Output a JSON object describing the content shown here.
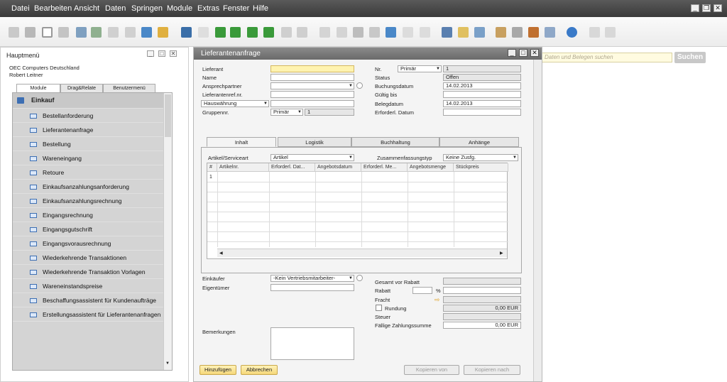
{
  "menubar": {
    "items": [
      "Datei",
      "Bearbeiten",
      "Ansicht",
      "Daten",
      "Springen",
      "Module",
      "Extras",
      "Fenster",
      "Hilfe"
    ]
  },
  "search": {
    "placeholder": "Daten und Belegen suchen",
    "button": "Suchen"
  },
  "hauptmenu": {
    "title": "Hauptmenü",
    "company": "OEC Computers Deutschland",
    "user": "Robert Leitner",
    "tabs": [
      "Module",
      "Drag&Relate",
      "Benutzermenü"
    ],
    "module": "Einkauf",
    "items": [
      "Bestellanforderung",
      "Lieferantenanfrage",
      "Bestellung",
      "Wareneingang",
      "Retoure",
      "Einkaufsanzahlungsanforderung",
      "Einkaufsanzahlungsrechnung",
      "Eingangsrechnung",
      "Eingangsgutschrift",
      "Eingangsvorausrechnung",
      "Wiederkehrende Transaktionen",
      "Wiederkehrende Transaktion Vorlagen",
      "Wareneinstandspreise",
      "Beschaffungsassistent für Kundenaufträge",
      "Erstellungsassistent für Lieferantenanfragen"
    ]
  },
  "dialog": {
    "title": "Lieferantenanfrage",
    "left": {
      "lieferant": "Lieferant",
      "name": "Name",
      "ansprechpartner": "Ansprechpartner",
      "refnr": "Lieferantenref.nr.",
      "waehrung": "Hauswährung",
      "gruppennr": "Gruppennr.",
      "gruppe_serie": "Primär",
      "gruppe_value": "1"
    },
    "right": {
      "nr": "Nr.",
      "nr_serie": "Primär",
      "nr_value": "1",
      "status": "Status",
      "status_value": "Offen",
      "buchungsdatum": "Buchungsdatum",
      "buchungsdatum_value": "14.02.2013",
      "gueltig": "Gültig bis",
      "belegdatum": "Belegdatum",
      "belegdatum_value": "14.02.2013",
      "erf_datum": "Erforderl. Datum"
    },
    "tabs": [
      "Inhalt",
      "Logistik",
      "Buchhaltung",
      "Anhänge"
    ],
    "content": {
      "artikel_label": "Artikel/Serviceart",
      "artikel_value": "Artikel",
      "zusammen_label": "Zusammenfassungstyp",
      "zusammen_value": "Keine Zusfg.",
      "columns": [
        "#",
        "Artikelnr.",
        "Erforderl. Dat...",
        "Angebotsdatum",
        "Erforderl. Me...",
        "Angebotsmenge",
        "Stückpreis"
      ],
      "row_number": "1"
    },
    "footer_left": {
      "einkaeufer": "Einkäufer",
      "einkaeufer_value": "-Kein Vertriebsmitarbeiter-",
      "eigentuemer": "Eigentümer",
      "bemerkungen": "Bemerkungen"
    },
    "totals": {
      "gesamt": "Gesamt vor Rabatt",
      "rabatt": "Rabatt",
      "percent": "%",
      "fracht": "Fracht",
      "rundung": "Rundung",
      "rundung_value": "0,00 EUR",
      "steuer": "Steuer",
      "faellig": "Fällige Zahlungssumme",
      "faellig_value": "0,00 EUR"
    },
    "buttons": {
      "add": "Hinzufügen",
      "cancel": "Abbrechen",
      "copy_from": "Kopieren von",
      "copy_to": "Kopieren nach"
    }
  },
  "colors": {
    "menubar": "#4a4a4a",
    "accent_yellow": "#f5d779",
    "item_blue": "#3d6fb3"
  }
}
